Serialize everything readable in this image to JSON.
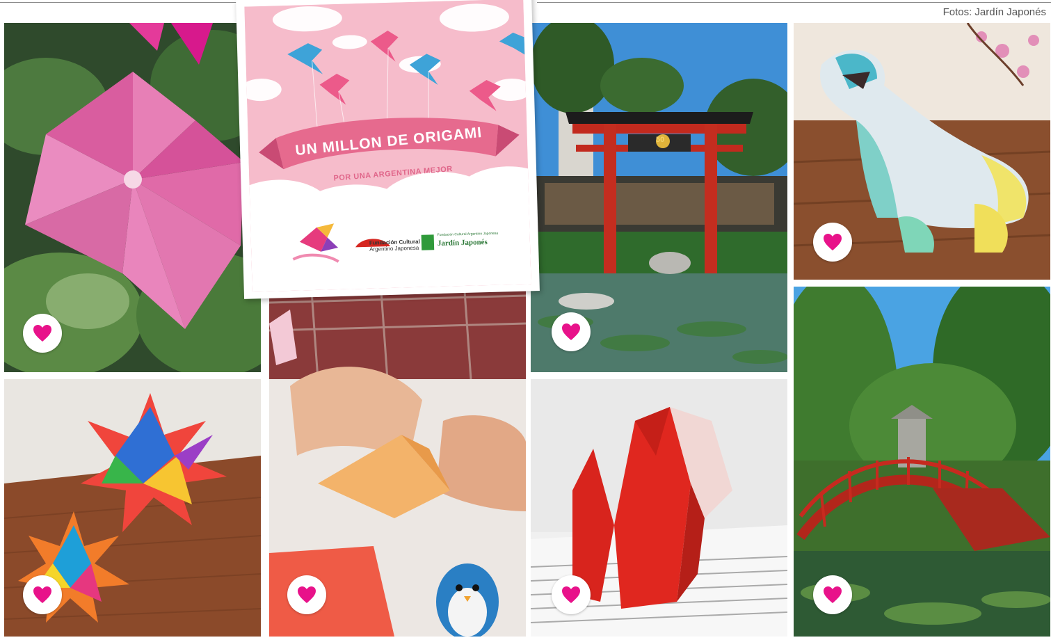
{
  "credit": "Fotos: Jardín Japonés",
  "poster": {
    "title": "UN MILLON DE ORIGAMI",
    "subtitle": "POR UNA ARGENTINA MEJOR",
    "org1_line1": "Fundación Cultural",
    "org1_line2": "Argentino Japonesa",
    "org2_small": "Fundación Cultural Argentino Japonesa",
    "org2_name": "Jardín Japonés",
    "gate_badge": "50"
  },
  "colors": {
    "heart": "#e8128a",
    "poster_pink": "#f6bccb",
    "banner_pink": "#e66a8e"
  },
  "icons": [
    "heart-icon"
  ]
}
